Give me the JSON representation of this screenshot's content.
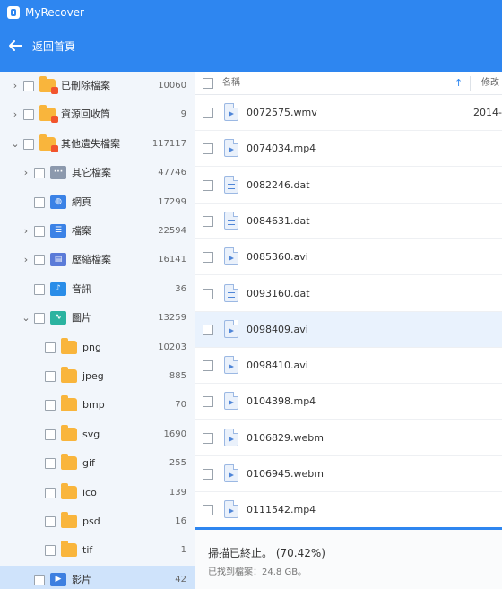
{
  "app": {
    "title": "MyRecover",
    "back_label": "返回首頁"
  },
  "colors": {
    "accent": "#2e86f0",
    "folder": "#f9b53c",
    "selected_row": "#cfe3fb"
  },
  "sidebar": {
    "items": [
      {
        "label": "已刪除檔案",
        "count": "10060",
        "icon": "deleted-folder-icon",
        "expand": "collapsed",
        "level": 0
      },
      {
        "label": "資源回收筒",
        "count": "9",
        "icon": "recycle-bin-icon",
        "expand": "collapsed",
        "level": 0
      },
      {
        "label": "其他遺失檔案",
        "count": "117117",
        "icon": "lost-folder-icon",
        "expand": "expanded",
        "level": 0
      },
      {
        "label": "其它檔案",
        "count": "47746",
        "icon": "other-files-icon",
        "expand": "collapsed",
        "level": 1
      },
      {
        "label": "網頁",
        "count": "17299",
        "icon": "webpage-icon",
        "expand": "none",
        "level": 1
      },
      {
        "label": "檔案",
        "count": "22594",
        "icon": "document-icon",
        "expand": "collapsed",
        "level": 1
      },
      {
        "label": "壓縮檔案",
        "count": "16141",
        "icon": "archive-icon",
        "expand": "collapsed",
        "level": 1
      },
      {
        "label": "音訊",
        "count": "36",
        "icon": "audio-icon",
        "expand": "none",
        "level": 1
      },
      {
        "label": "圖片",
        "count": "13259",
        "icon": "image-icon",
        "expand": "expanded",
        "level": 1
      },
      {
        "label": "png",
        "count": "10203",
        "icon": "folder-icon",
        "expand": "none",
        "level": 2
      },
      {
        "label": "jpeg",
        "count": "885",
        "icon": "folder-icon",
        "expand": "none",
        "level": 2
      },
      {
        "label": "bmp",
        "count": "70",
        "icon": "folder-icon",
        "expand": "none",
        "level": 2
      },
      {
        "label": "svg",
        "count": "1690",
        "icon": "folder-icon",
        "expand": "none",
        "level": 2
      },
      {
        "label": "gif",
        "count": "255",
        "icon": "folder-icon",
        "expand": "none",
        "level": 2
      },
      {
        "label": "ico",
        "count": "139",
        "icon": "folder-icon",
        "expand": "none",
        "level": 2
      },
      {
        "label": "psd",
        "count": "16",
        "icon": "folder-icon",
        "expand": "none",
        "level": 2
      },
      {
        "label": "tif",
        "count": "1",
        "icon": "folder-icon",
        "expand": "none",
        "level": 2
      },
      {
        "label": "影片",
        "count": "42",
        "icon": "video-icon",
        "expand": "none",
        "level": 1,
        "selected": true
      }
    ]
  },
  "list": {
    "header": {
      "name": "名稱",
      "sort_icon": "↑",
      "modified": "修改"
    },
    "files": [
      {
        "name": "0072575.wmv",
        "kind": "video",
        "date": "2014-"
      },
      {
        "name": "0074034.mp4",
        "kind": "video",
        "date": ""
      },
      {
        "name": "0082246.dat",
        "kind": "data",
        "date": ""
      },
      {
        "name": "0084631.dat",
        "kind": "data",
        "date": ""
      },
      {
        "name": "0085360.avi",
        "kind": "video",
        "date": ""
      },
      {
        "name": "0093160.dat",
        "kind": "data",
        "date": ""
      },
      {
        "name": "0098409.avi",
        "kind": "video",
        "date": "",
        "hover": true
      },
      {
        "name": "0098410.avi",
        "kind": "video",
        "date": ""
      },
      {
        "name": "0104398.mp4",
        "kind": "video",
        "date": ""
      },
      {
        "name": "0106829.webm",
        "kind": "video",
        "date": ""
      },
      {
        "name": "0106945.webm",
        "kind": "video",
        "date": ""
      },
      {
        "name": "0111542.mp4",
        "kind": "video",
        "date": ""
      }
    ]
  },
  "status": {
    "main": "掃描已終止。 (70.42%)",
    "found": "已找到檔案：24.8 GB。"
  }
}
